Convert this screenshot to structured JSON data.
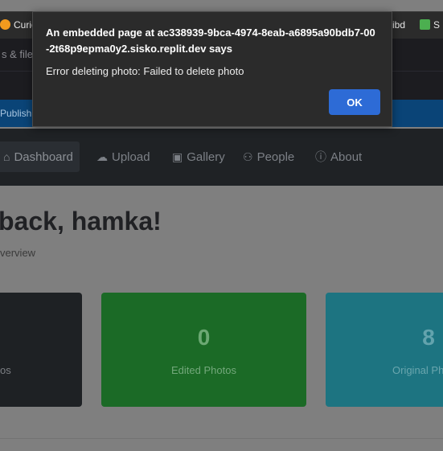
{
  "browser": {
    "bookmarks": [
      {
        "label": "Curio",
        "color": "#f29a1e"
      },
      {
        "label": "ibd",
        "color": ""
      },
      {
        "label": "S",
        "color": "#4caf50"
      }
    ]
  },
  "replit": {
    "files_label": "s & files",
    "publish_label": "Publish"
  },
  "navbar": {
    "items": [
      {
        "label": "Dashboard",
        "icon": "home-icon",
        "active": true
      },
      {
        "label": "Upload",
        "icon": "cloud-upload-icon"
      },
      {
        "label": "Gallery",
        "icon": "image-icon"
      },
      {
        "label": "People",
        "icon": "people-icon"
      },
      {
        "label": "About",
        "icon": "info-icon"
      }
    ]
  },
  "main": {
    "welcome": "back, hamka!",
    "subtitle": "verview",
    "cards": [
      {
        "value": "",
        "label": "os",
        "color": "#1e2124"
      },
      {
        "value": "0",
        "label": "Edited Photos",
        "color": "#1b6a26"
      },
      {
        "value": "8",
        "label": "Original Ph",
        "color": "#1d7481"
      }
    ]
  },
  "dialog": {
    "title": "An embedded page at ac338939-9bca-4974-8eab-a6895a90bdb7-00-2t68p9epma0y2.sisko.replit.dev says",
    "message": "Error deleting photo: Failed to delete photo",
    "ok_label": "OK"
  }
}
